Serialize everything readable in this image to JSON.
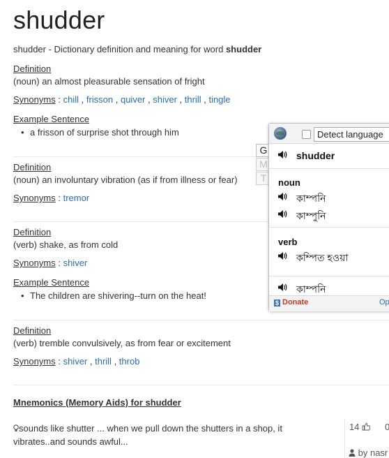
{
  "word": "shudder",
  "subtitle": {
    "prefix": "shudder - Dictionary definition and meaning for word ",
    "word": "shudder"
  },
  "labels": {
    "definition": "Definition",
    "synonyms": "Synonyms",
    "example": "Example Sentence",
    "sep": ":"
  },
  "senses": [
    {
      "definition": "(noun) an almost pleasurable sensation of fright",
      "synonyms": [
        "chill",
        "frisson",
        "quiver",
        "shiver",
        "thrill",
        "tingle"
      ],
      "example": "a frisson of surprise shot through him"
    },
    {
      "definition": "(noun) an involuntary vibration (as if from illness or fear)",
      "synonyms": [
        "tremor"
      ]
    },
    {
      "definition": "(verb) shake, as from cold",
      "synonyms": [
        "shiver"
      ],
      "example": "The children are shivering--turn on the heat!"
    },
    {
      "definition": "(verb) tremble convulsively, as from fear or excitement",
      "synonyms": [
        "shiver",
        "thrill",
        "throb"
      ]
    }
  ],
  "mnemonics": {
    "title": "Mnemonics (Memory Aids) for shudder",
    "text": "sounds like shutter ... when we pull down the shutters in a shop, it vibrates..and sounds awful...",
    "votes": "14",
    "votes2": "0",
    "author": "by nasr"
  },
  "translate_popup": {
    "detect_label": "Detect language",
    "tabs": [
      "G",
      "M",
      "T"
    ],
    "word": "shudder",
    "noun_label": "noun",
    "noun": [
      "কাম্পনি",
      "কাম্পুনি"
    ],
    "verb_label": "verb",
    "verb": [
      "কম্পিত হওয়া",
      "কাম্পনি"
    ],
    "donate": "Donate",
    "options": "Op"
  },
  "icons": {
    "speaker": "speaker-icon",
    "thumbs_up": "thumbs-up-icon",
    "user": "user-icon",
    "lightbulb": "lightbulb-icon",
    "globe": "globe-icon"
  },
  "colors": {
    "link": "#2a6db0",
    "text": "#333333",
    "donate": "#c0392b"
  }
}
